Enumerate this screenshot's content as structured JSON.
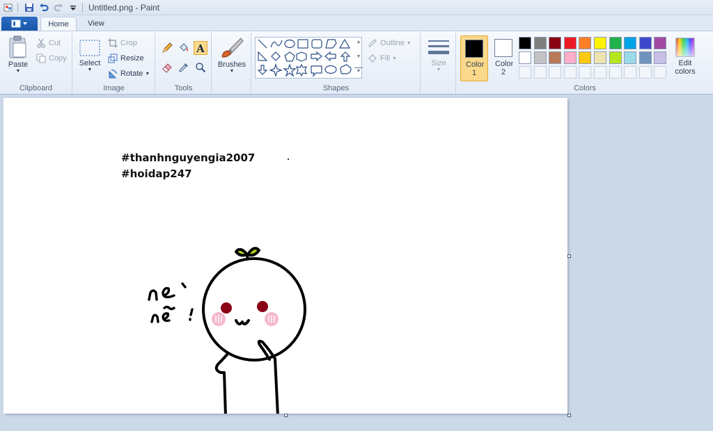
{
  "window": {
    "title": "Untitled.png - Paint"
  },
  "tabs": {
    "home": "Home",
    "view": "View"
  },
  "clipboard": {
    "paste": "Paste",
    "cut": "Cut",
    "copy": "Copy",
    "group": "Clipboard"
  },
  "image": {
    "select": "Select",
    "crop": "Crop",
    "resize": "Resize",
    "rotate": "Rotate",
    "group": "Image"
  },
  "tools": {
    "group": "Tools"
  },
  "brushes": {
    "label": "Brushes"
  },
  "shapes": {
    "outline": "Outline",
    "fill": "Fill",
    "group": "Shapes"
  },
  "size": {
    "label": "Size"
  },
  "colors": {
    "color1": "Color 1",
    "color2": "Color 2",
    "edit": "Edit colors",
    "group": "Colors",
    "color1_value": "#000000",
    "color2_value": "#ffffff",
    "palette_row1": [
      "#000000",
      "#7f7f7f",
      "#880015",
      "#ed1c24",
      "#ff7f27",
      "#fff200",
      "#22b14c",
      "#00a2e8",
      "#3f48cc",
      "#a349a4"
    ],
    "palette_row2": [
      "#ffffff",
      "#c3c3c3",
      "#b97a57",
      "#ffaec9",
      "#ffc90e",
      "#efe4b0",
      "#b5e61d",
      "#99d9ea",
      "#7092be",
      "#c8bfe7"
    ]
  },
  "canvas": {
    "hashtag1": "#thanhnguyengia2007",
    "hashtag2": "#hoidap247",
    "handwriting": "nè nè !"
  }
}
